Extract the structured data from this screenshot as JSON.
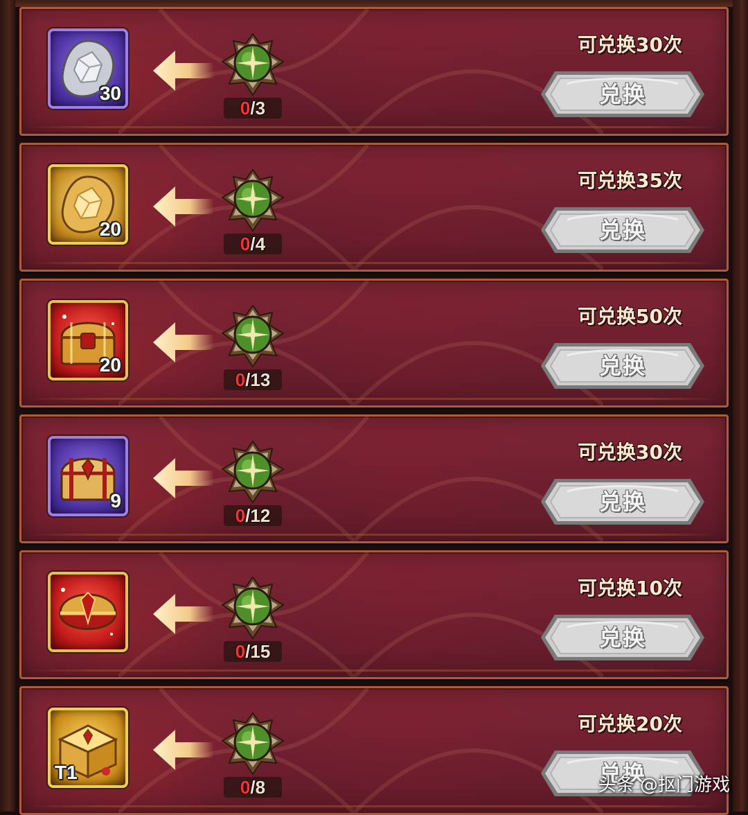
{
  "rows": [
    {
      "icon": "silver-gem-icon",
      "frame": "purple",
      "qty": "30",
      "progress_current": "0",
      "progress_total": "/3",
      "limit": "可兑换30次",
      "button": "兑换"
    },
    {
      "icon": "gold-gem-icon",
      "frame": "gold",
      "qty": "20",
      "progress_current": "0",
      "progress_total": "/4",
      "limit": "可兑换35次",
      "button": "兑换"
    },
    {
      "icon": "red-treasure-chest-icon",
      "frame": "red",
      "qty": "20",
      "progress_current": "0",
      "progress_total": "/13",
      "limit": "可兑换50次",
      "button": "兑换"
    },
    {
      "icon": "purple-treasure-chest-icon",
      "frame": "purple",
      "qty": "9",
      "progress_current": "0",
      "progress_total": "/12",
      "limit": "可兑换30次",
      "button": "兑换"
    },
    {
      "icon": "red-gold-chest-icon",
      "frame": "red",
      "qty": "",
      "progress_current": "0",
      "progress_total": "/15",
      "limit": "可兑换10次",
      "button": "兑换"
    },
    {
      "icon": "golden-gem-box-icon",
      "frame": "goldbox",
      "qty": "T1",
      "progress_current": "0",
      "progress_total": "/8",
      "limit": "可兑换20次",
      "button": "兑换"
    }
  ],
  "watermark": "头条 @抠门游戏",
  "colors": {
    "row_bg": "#6e1f2f",
    "row_border": "#b05a3c",
    "progress_current": "#ff3030",
    "button": "#c9c9c9"
  }
}
